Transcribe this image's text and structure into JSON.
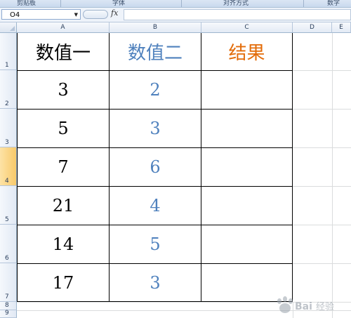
{
  "ribbon": {
    "groups": [
      "剪贴板",
      "字体",
      "对齐方式",
      "数字"
    ]
  },
  "formula_bar": {
    "name_box": "O4",
    "fx_label": "fx",
    "formula": ""
  },
  "columns": [
    "A",
    "B",
    "C",
    "D",
    "E"
  ],
  "rows": [
    "1",
    "2",
    "3",
    "4",
    "5",
    "6",
    "7",
    "8",
    "9"
  ],
  "selected_row": "4",
  "table": {
    "headers": [
      "数值一",
      "数值二",
      "结果"
    ],
    "header_colors": [
      "#000000",
      "#4f81bd",
      "#e36c09"
    ],
    "rows": [
      [
        "3",
        "2",
        ""
      ],
      [
        "5",
        "3",
        ""
      ],
      [
        "7",
        "6",
        ""
      ],
      [
        "21",
        "4",
        ""
      ],
      [
        "14",
        "5",
        ""
      ],
      [
        "17",
        "3",
        ""
      ]
    ]
  },
  "watermark": "Bai 经验"
}
